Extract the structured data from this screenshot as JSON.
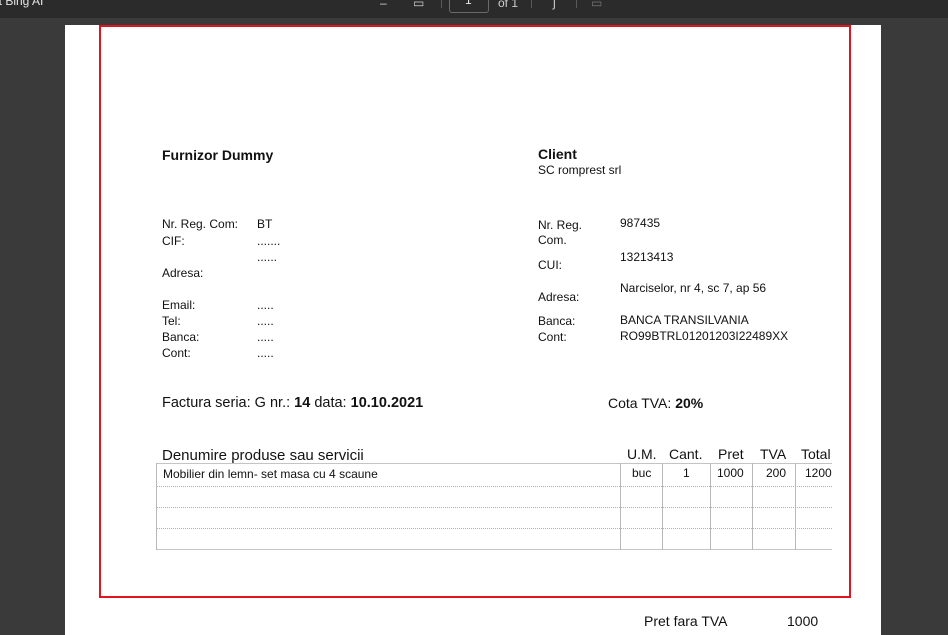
{
  "app": {
    "title": "ot Bing AI",
    "page_input": "1",
    "page_total": "of 1"
  },
  "supplier": {
    "heading": "Furnizor Dummy",
    "reg_label": "Nr. Reg. Com:",
    "reg_value": "BT",
    "cif_label": "CIF:",
    "cif_value": ".......",
    "extra_value": "......",
    "address_label": "Adresa:",
    "email_label": "Email:",
    "email_value": ".....",
    "tel_label": "Tel:",
    "tel_value": ".....",
    "bank_label": "Banca:",
    "bank_value": ".....",
    "account_label": "Cont:",
    "account_value": "....."
  },
  "client": {
    "heading": "Client",
    "name": "SC romprest srl",
    "reg_label_1": "Nr. Reg.",
    "reg_label_2": "Com.",
    "reg_value": "987435",
    "cui_label": "CUI:",
    "cui_value": "13213413",
    "address_label": "Adresa:",
    "address_value": "Narciselor, nr 4, sc 7, ap 56",
    "bank_label": "Banca:",
    "bank_value": "BANCA TRANSILVANIA",
    "account_label": "Cont:",
    "account_value": "RO99BTRL01201203I22489XX"
  },
  "invoice": {
    "series_prefix": "Factura seria: G  nr.: ",
    "number": "14",
    "date_prefix": " data: ",
    "date": "10.10.2021",
    "vat_label": "Cota TVA: ",
    "vat_value": "20%"
  },
  "table": {
    "headers": {
      "product": "Denumire produse sau servicii",
      "um": "U.M.",
      "qty": "Cant.",
      "price": "Pret",
      "vat": "TVA",
      "total": "Total"
    },
    "rows": [
      {
        "product": "Mobilier din lemn- set masa cu 4 scaune",
        "um": "buc",
        "qty": "1",
        "price": "1000",
        "vat": "200",
        "total": "1200"
      }
    ]
  },
  "footer": {
    "label": "Pret fara TVA",
    "value": "1000"
  }
}
